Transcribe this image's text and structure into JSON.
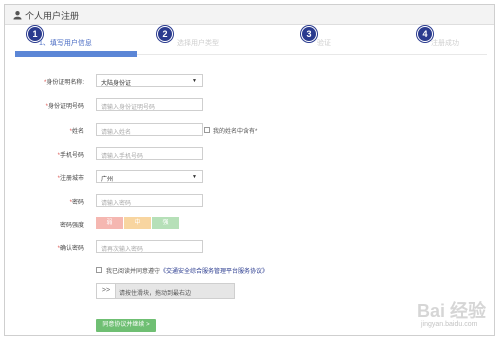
{
  "header": {
    "title": "个人用户注册"
  },
  "steps": [
    {
      "num": "1",
      "label": "1、填写用户信息"
    },
    {
      "num": "2",
      "label": "选择用户类型"
    },
    {
      "num": "3",
      "label": "验证"
    },
    {
      "num": "4",
      "label": "注册成功"
    }
  ],
  "form": {
    "id_type": {
      "label": "身份证明名称:",
      "value": "大陆身份证"
    },
    "id_number": {
      "label": "身份证明号码",
      "placeholder": "请输入身份证明号码"
    },
    "name": {
      "label": "姓名",
      "placeholder": "请输入姓名",
      "rare_char_label": "我的姓名中含有*"
    },
    "phone": {
      "label": "手机号码",
      "placeholder": "请输入手机号码"
    },
    "city": {
      "label": "注册城市",
      "value": "广州"
    },
    "password": {
      "label": "密码",
      "placeholder": "请输入密码"
    },
    "strength": {
      "label": "密码强度",
      "levels": [
        "弱",
        "中",
        "强"
      ],
      "colors": [
        "#f5b7b1",
        "#f8d5a0",
        "#b6e0b8"
      ]
    },
    "confirm": {
      "label": "确认密码",
      "placeholder": "请再次输入密码"
    },
    "agreement": {
      "prefix": "我已阅读并同意遵守",
      "link": "《交通安全综合服务管理平台服务协议》"
    },
    "slider": {
      "handle": ">>",
      "text": "请按住滑块，拖动到最右边"
    },
    "submit": "同意协议并继续 >"
  },
  "watermark": {
    "line1": "Bai 经验",
    "line2": "jingyan.baidu.com"
  }
}
